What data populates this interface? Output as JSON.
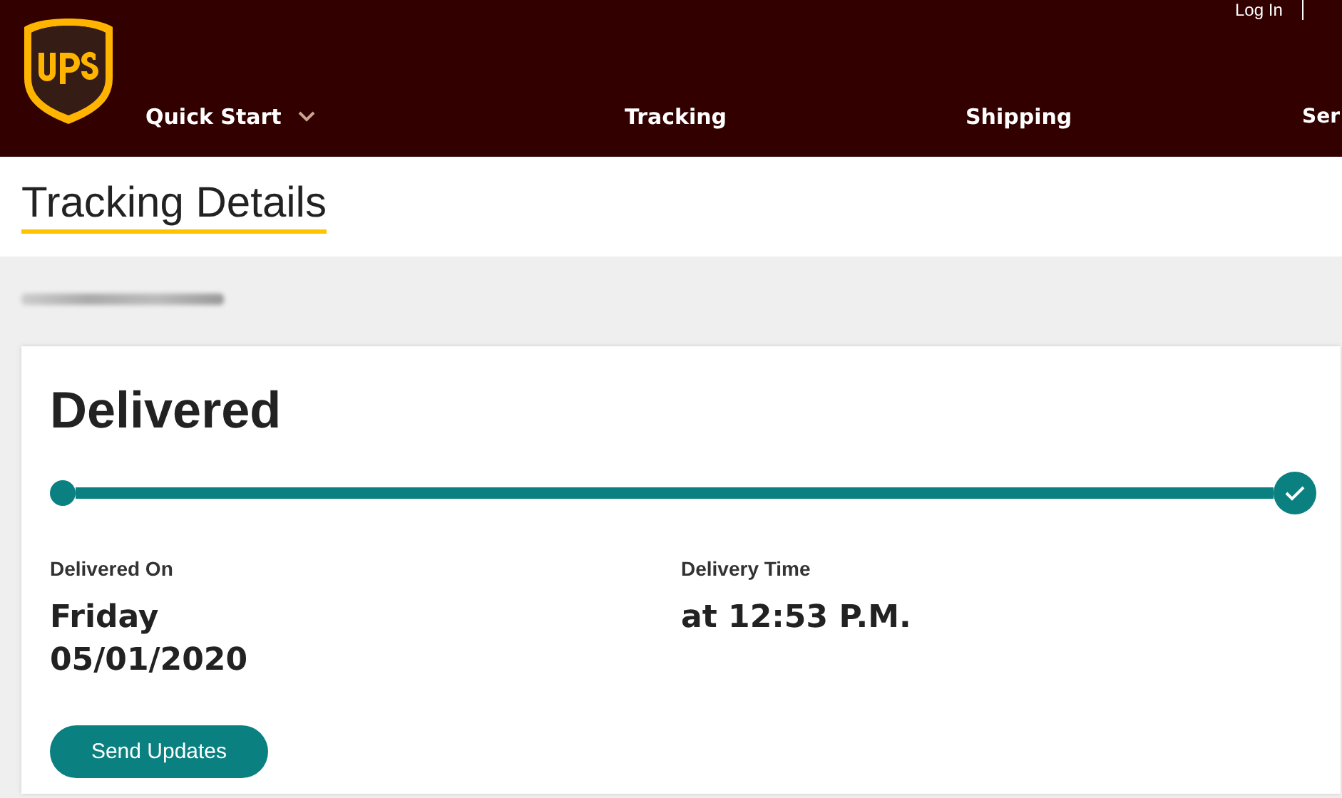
{
  "header": {
    "utility_link": "Log In",
    "nav": [
      {
        "label": "Quick Start",
        "has_menu": true
      },
      {
        "label": "Tracking",
        "has_menu": false
      },
      {
        "label": "Shipping",
        "has_menu": false
      },
      {
        "label": "Ser",
        "has_menu": false
      }
    ]
  },
  "page_title": "Tracking Details",
  "shipment": {
    "status": "Delivered",
    "progress": {
      "level": 1,
      "complete": true
    },
    "details": [
      {
        "label": "Delivered On",
        "value_lines": [
          "Friday",
          "05/01/2020"
        ]
      },
      {
        "label": "Delivery Time",
        "value_lines": [
          "at 12:53 P.M."
        ]
      }
    ],
    "button": "Send Updates"
  }
}
